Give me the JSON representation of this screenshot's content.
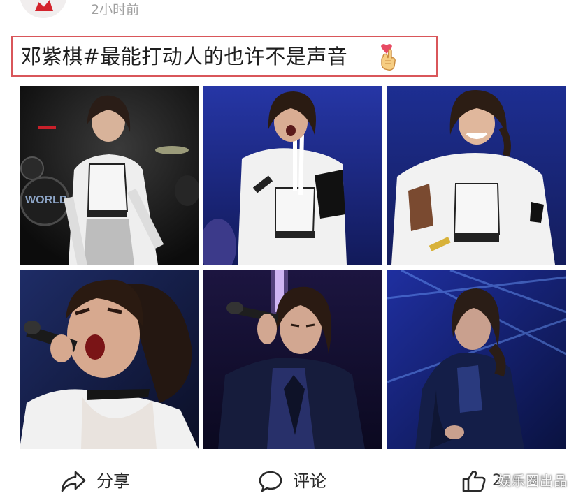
{
  "header": {
    "time": "2小时前"
  },
  "post": {
    "text": "邓紫棋#最能打动人的也许不是声音",
    "emoji_icon": "finger-heart-icon"
  },
  "photos": [
    {
      "name": "photo-1",
      "scene": "drum-stage",
      "bg": "#141414"
    },
    {
      "name": "photo-2",
      "scene": "blue-stage-singing",
      "bg": "#1c2a86"
    },
    {
      "name": "photo-3",
      "scene": "blue-stage-smiling",
      "bg": "#1b2a7a"
    },
    {
      "name": "photo-4",
      "scene": "closeup-microphone",
      "bg": "#121c46"
    },
    {
      "name": "photo-5",
      "scene": "purple-stage-eyes-closed",
      "bg": "#140f33"
    },
    {
      "name": "photo-6",
      "scene": "blue-lights-sitting",
      "bg": "#0f1a5e"
    }
  ],
  "actions": {
    "share_label": "分享",
    "comment_label": "评论",
    "like_count": "2"
  },
  "watermark": "娱乐圈出品",
  "colors": {
    "highlight_border": "#d9565a",
    "time_text": "#a0a0a0"
  }
}
